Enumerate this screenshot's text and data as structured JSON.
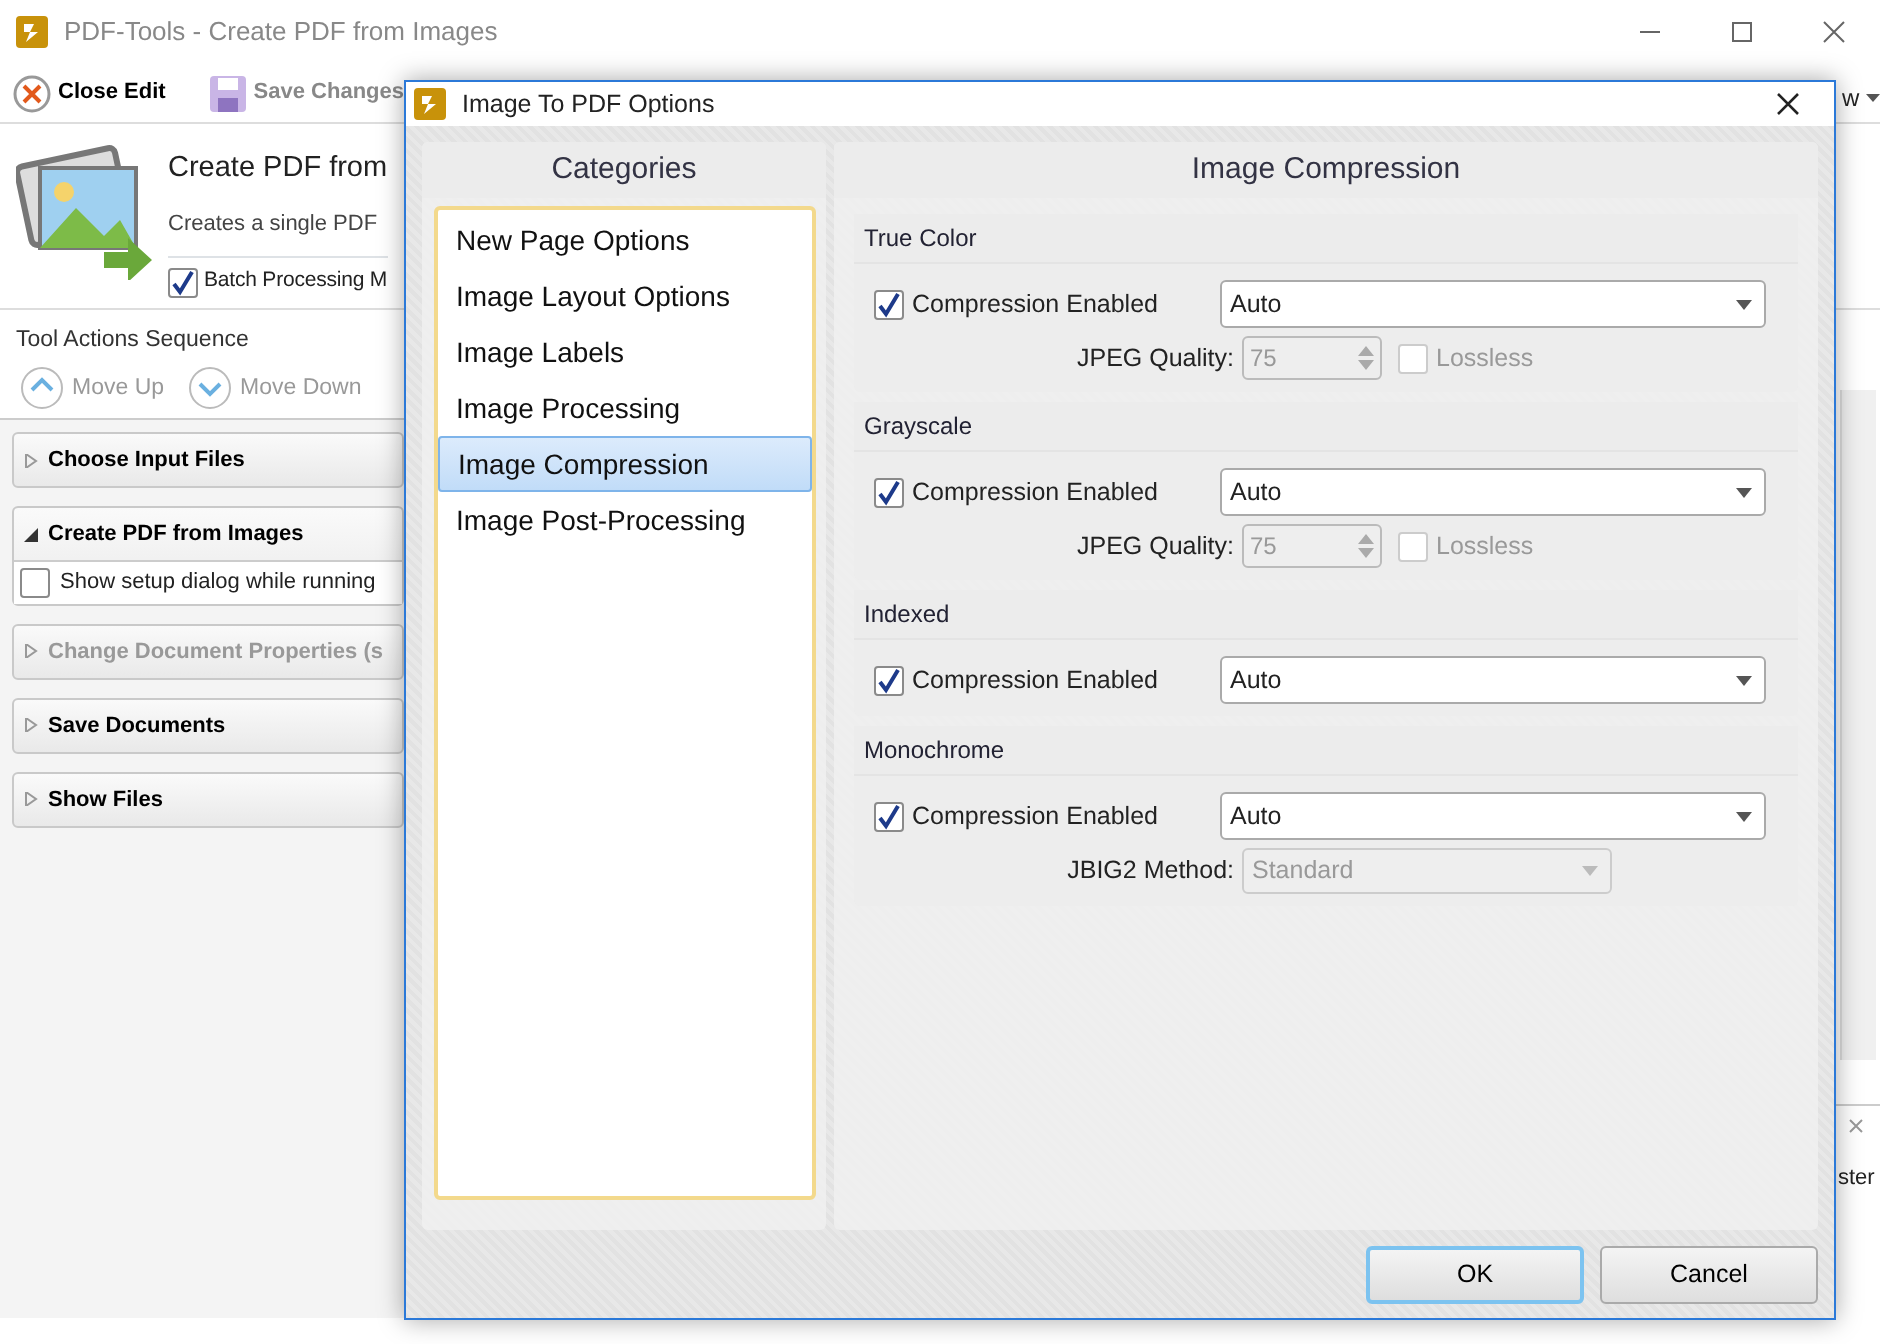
{
  "app": {
    "title": "PDF-Tools - Create PDF from Images",
    "toolbar": [
      {
        "label": "Close Edit",
        "kind": "close",
        "disabled": false
      },
      {
        "label": "Save Changes",
        "kind": "save",
        "disabled": true
      }
    ],
    "toolbar_right": "w",
    "header": {
      "title": "Create PDF from",
      "description": "Creates a single PDF",
      "batch": {
        "label": "Batch Processing M",
        "checked": true
      }
    },
    "sequence_title": "Tool Actions Sequence",
    "sequence_buttons": [
      {
        "label": "Move Up",
        "kind": "up"
      },
      {
        "label": "Move Down",
        "kind": "down"
      }
    ],
    "actions": [
      {
        "label": "Choose Input Files",
        "expanded": false,
        "disabled": false
      },
      {
        "label": "Create PDF from Images",
        "expanded": true,
        "disabled": false,
        "option": {
          "label": "Show setup dialog while running",
          "checked": false
        }
      },
      {
        "label": "Change Document Properties (s",
        "expanded": false,
        "disabled": true
      },
      {
        "label": "Save Documents",
        "expanded": false,
        "disabled": false
      },
      {
        "label": "Show Files",
        "expanded": false,
        "disabled": false
      }
    ],
    "side_panel": {
      "text": "ster"
    }
  },
  "dialog": {
    "title": "Image To PDF Options",
    "categories_title": "Categories",
    "categories": [
      {
        "label": "New Page Options",
        "selected": false
      },
      {
        "label": "Image Layout Options",
        "selected": false
      },
      {
        "label": "Image Labels",
        "selected": false
      },
      {
        "label": "Image Processing",
        "selected": false
      },
      {
        "label": "Image Compression",
        "selected": true
      },
      {
        "label": "Image Post-Processing",
        "selected": false
      }
    ],
    "section_title": "Image Compression",
    "groups": [
      {
        "title": "True Color",
        "compression": {
          "label": "Compression Enabled",
          "checked": true,
          "value": "Auto"
        },
        "quality": {
          "label": "JPEG Quality:",
          "value": "75",
          "lossless": {
            "label": "Lossless",
            "checked": false
          }
        }
      },
      {
        "title": "Grayscale",
        "compression": {
          "label": "Compression Enabled",
          "checked": true,
          "value": "Auto"
        },
        "quality": {
          "label": "JPEG Quality:",
          "value": "75",
          "lossless": {
            "label": "Lossless",
            "checked": false
          }
        }
      },
      {
        "title": "Indexed",
        "compression": {
          "label": "Compression Enabled",
          "checked": true,
          "value": "Auto"
        }
      },
      {
        "title": "Monochrome",
        "compression": {
          "label": "Compression Enabled",
          "checked": true,
          "value": "Auto"
        },
        "jbig2": {
          "label": "JBIG2 Method:",
          "value": "Standard"
        }
      }
    ],
    "buttons": [
      {
        "label": "OK",
        "default": true
      },
      {
        "label": "Cancel",
        "default": false
      }
    ]
  }
}
